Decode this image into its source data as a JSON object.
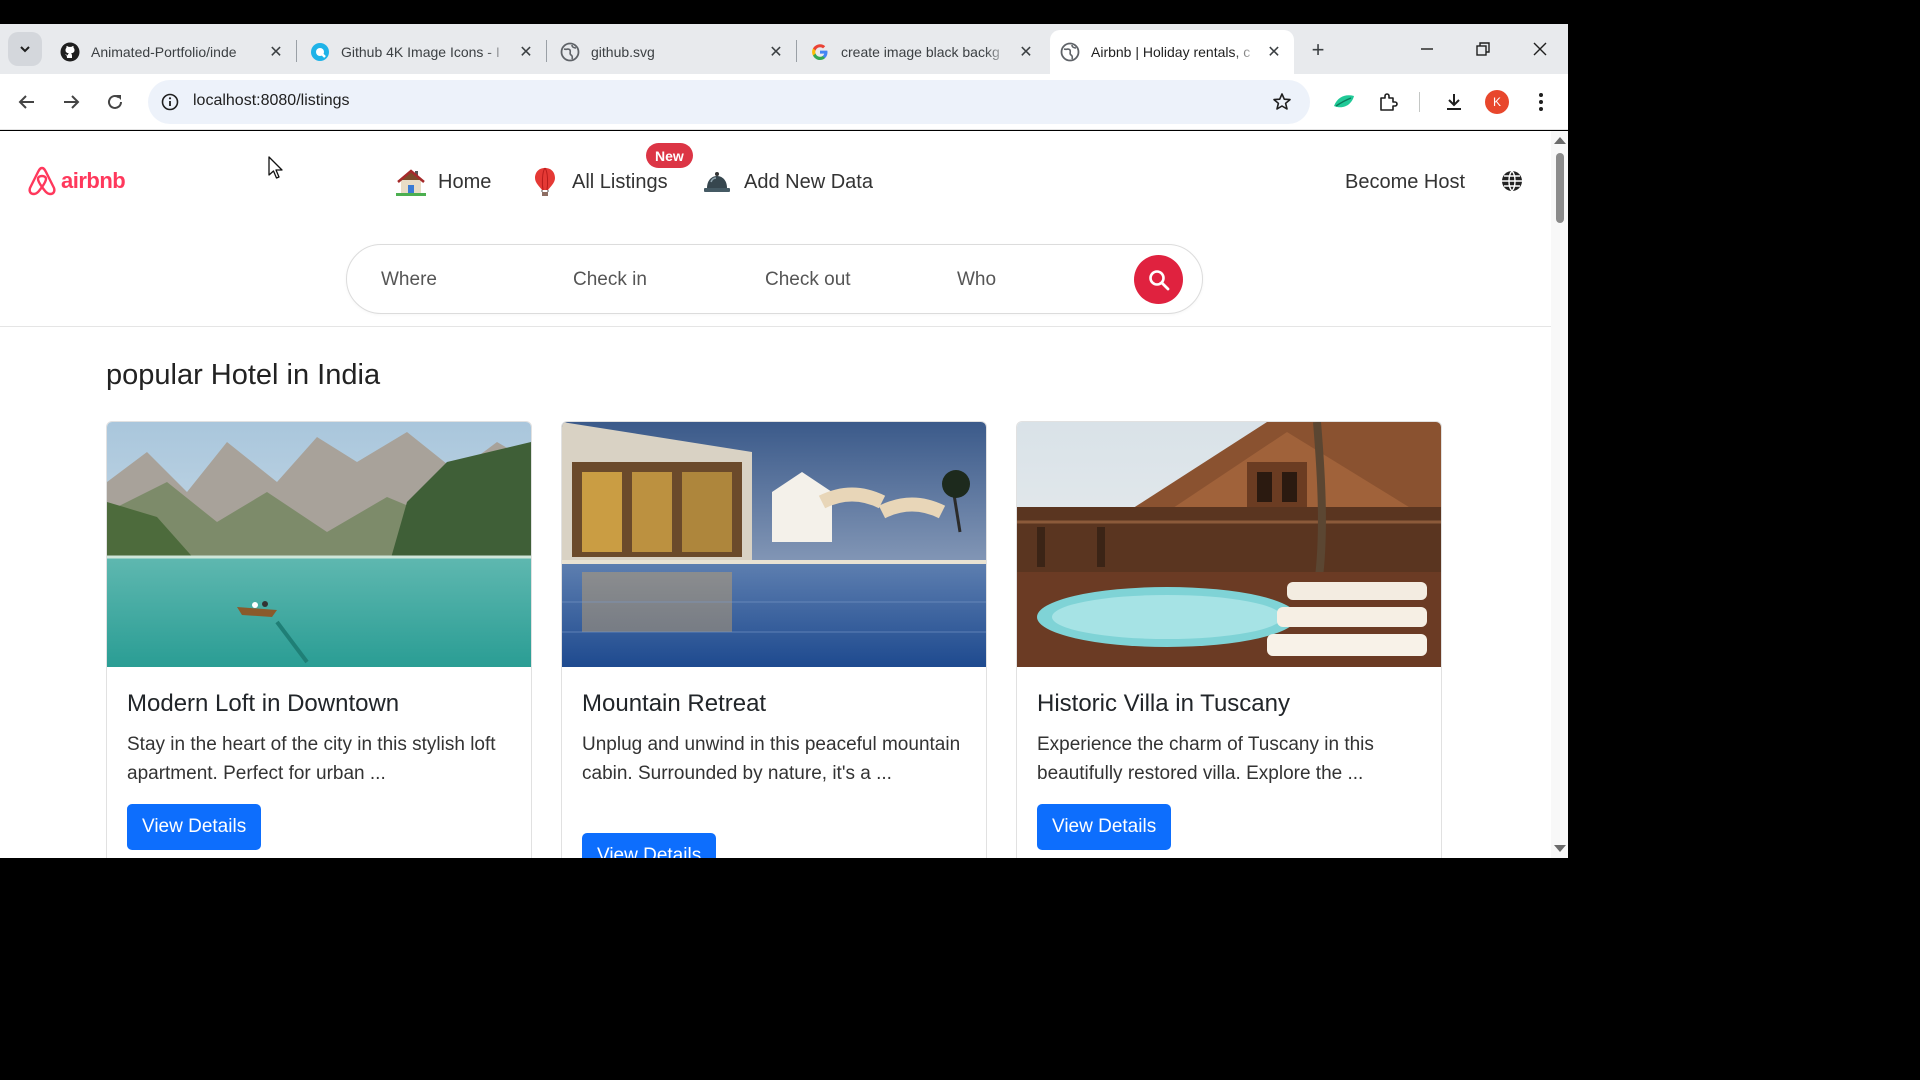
{
  "browser": {
    "tabs": [
      {
        "title": "Animated-Portfolio/inde",
        "icon": "github-icon",
        "active": false
      },
      {
        "title": "Github 4K Image Icons - I",
        "icon": "icons8-icon",
        "active": false
      },
      {
        "title": "github.svg",
        "icon": "globe-icon",
        "active": false
      },
      {
        "title": "create image black backg",
        "icon": "google-icon",
        "active": false
      },
      {
        "title": "Airbnb | Holiday rentals, c",
        "icon": "globe-icon",
        "active": true
      }
    ],
    "address": "localhost:8080/listings",
    "profile_initial": "K"
  },
  "site": {
    "logo_text": "airbnb",
    "nav": {
      "home": "Home",
      "all_listings": "All Listings",
      "new_badge": "New",
      "add_new": "Add New Data",
      "become_host": "Become Host"
    },
    "search": {
      "where": "Where",
      "check_in": "Check in",
      "check_out": "Check out",
      "who": "Who"
    },
    "section_title": "popular Hotel in India",
    "cards": [
      {
        "title": "Modern Loft in Downtown",
        "desc": "Stay in the heart of the city in this stylish loft apartment. Perfect for urban ...",
        "button": "View Details",
        "image": "mountain lake with rowing boat"
      },
      {
        "title": "Mountain Retreat",
        "desc": "Unplug and unwind in this peaceful mountain cabin. Surrounded by nature, it's a ...",
        "button": "View Details",
        "image": "resort pool at dusk"
      },
      {
        "title": "Historic Villa in Tuscany",
        "desc": "Experience the charm of Tuscany in this beautifully restored villa. Explore the ...",
        "button": "View Details",
        "image": "wooden villa with pool and sun loungers"
      }
    ]
  },
  "colors": {
    "brand": "#ff385c",
    "search_button": "#e0223f",
    "primary_button": "#0d6efd",
    "badge": "#dc3545"
  }
}
